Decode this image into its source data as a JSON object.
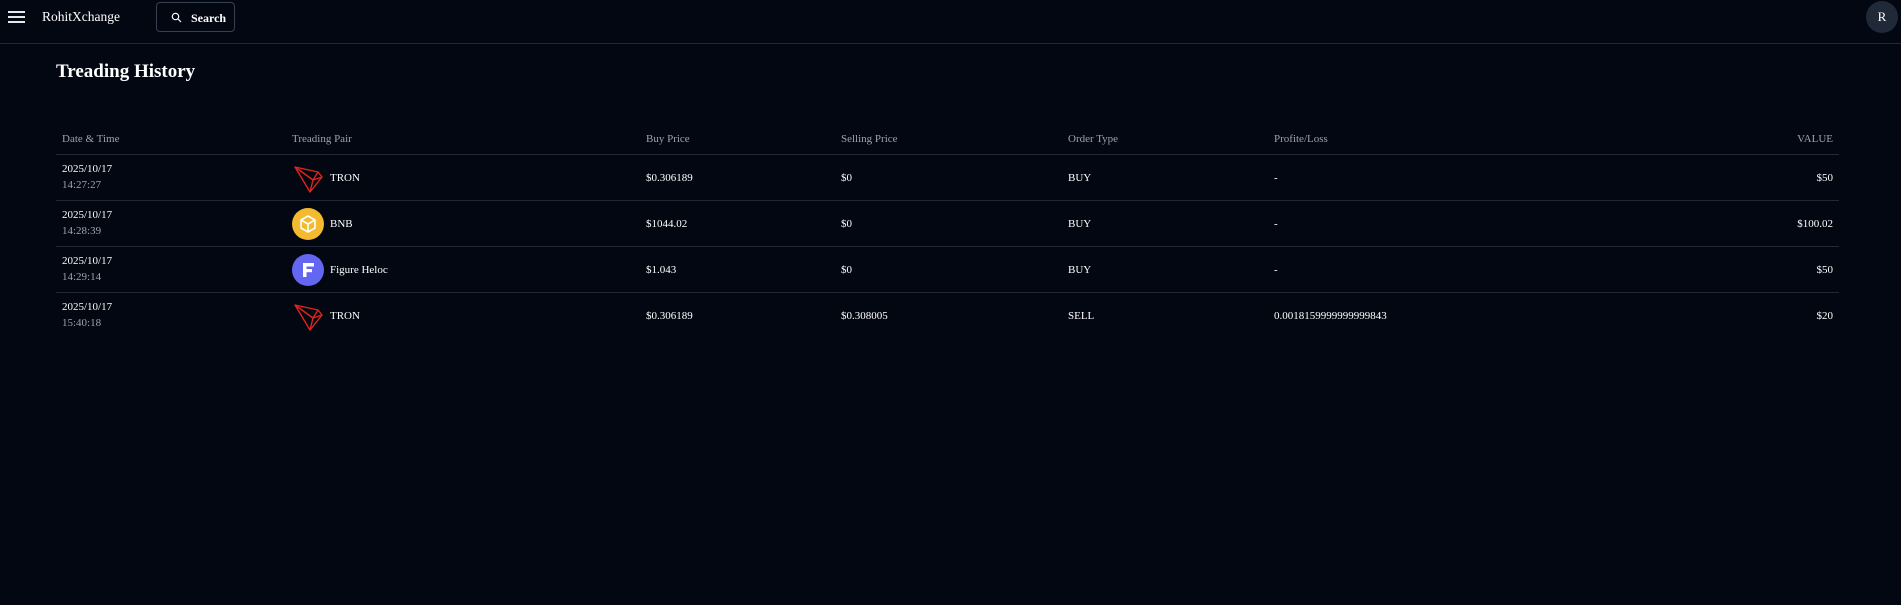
{
  "app": {
    "brand": "RohitXchange",
    "search_label": "Search",
    "avatar_initial": "R"
  },
  "page": {
    "title": "Treading History"
  },
  "table": {
    "headers": {
      "date": "Date & Time",
      "pair": "Treading Pair",
      "buy": "Buy Price",
      "sell": "Selling Price",
      "type": "Order Type",
      "pl": "Profite/Loss",
      "value": "VALUE"
    },
    "rows": [
      {
        "date": "2025/10/17",
        "time": "14:27:27",
        "pair": "TRON",
        "icon": "tron-icon",
        "buy": "$0.306189",
        "sell": "$0",
        "type": "BUY",
        "pl": "-",
        "value": "$50"
      },
      {
        "date": "2025/10/17",
        "time": "14:28:39",
        "pair": "BNB",
        "icon": "bnb-icon",
        "buy": "$1044.02",
        "sell": "$0",
        "type": "BUY",
        "pl": "-",
        "value": "$100.02"
      },
      {
        "date": "2025/10/17",
        "time": "14:29:14",
        "pair": "Figure Heloc",
        "icon": "figure-heloc-icon",
        "buy": "$1.043",
        "sell": "$0",
        "type": "BUY",
        "pl": "-",
        "value": "$50"
      },
      {
        "date": "2025/10/17",
        "time": "15:40:18",
        "pair": "TRON",
        "icon": "tron-icon",
        "buy": "$0.306189",
        "sell": "$0.308005",
        "type": "SELL",
        "pl": "0.0018159999999999843",
        "value": "$20"
      }
    ]
  },
  "colors": {
    "background": "#030712",
    "border": "#1f2937",
    "muted_text": "#9ca3af",
    "tron_red": "#e0241a",
    "bnb_yellow": "#f3ba2f",
    "figure_purple": "#6366f1"
  }
}
